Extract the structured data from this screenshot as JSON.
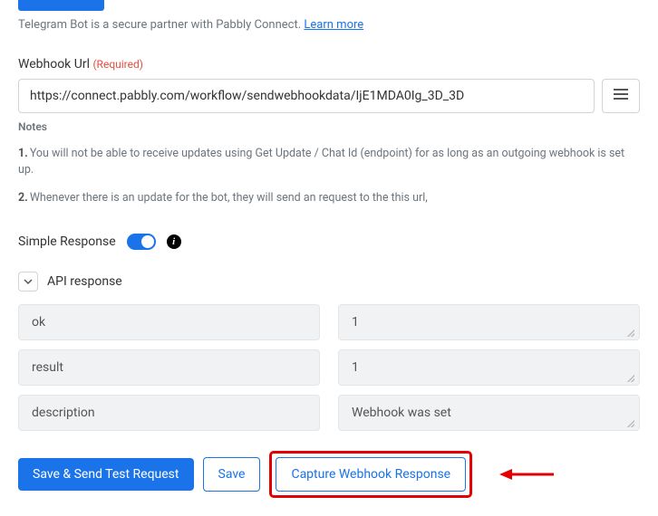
{
  "top": {
    "intro_text": "Telegram Bot is a secure partner with Pabbly Connect.",
    "learn_more": "Learn more"
  },
  "webhook": {
    "label": "Webhook Url",
    "required": "(Required)",
    "value": "https://connect.pabbly.com/workflow/sendwebhookdata/IjE1MDA0Ig_3D_3D",
    "notes_heading": "Notes",
    "note1": "You will not be able to receive updates using Get Update / Chat Id (endpoint) for as long as an outgoing webhook is set up.",
    "note2": "Whenever there is an update for the bot, they will send an request to the this url,"
  },
  "simple_response": {
    "label": "Simple Response"
  },
  "api": {
    "dropdown_label": "API response",
    "rows": [
      {
        "key": "ok",
        "value": "1"
      },
      {
        "key": "result",
        "value": "1"
      },
      {
        "key": "description",
        "value": "Webhook was set"
      }
    ]
  },
  "buttons": {
    "save_send": "Save & Send Test Request",
    "save": "Save",
    "capture": "Capture Webhook Response"
  }
}
